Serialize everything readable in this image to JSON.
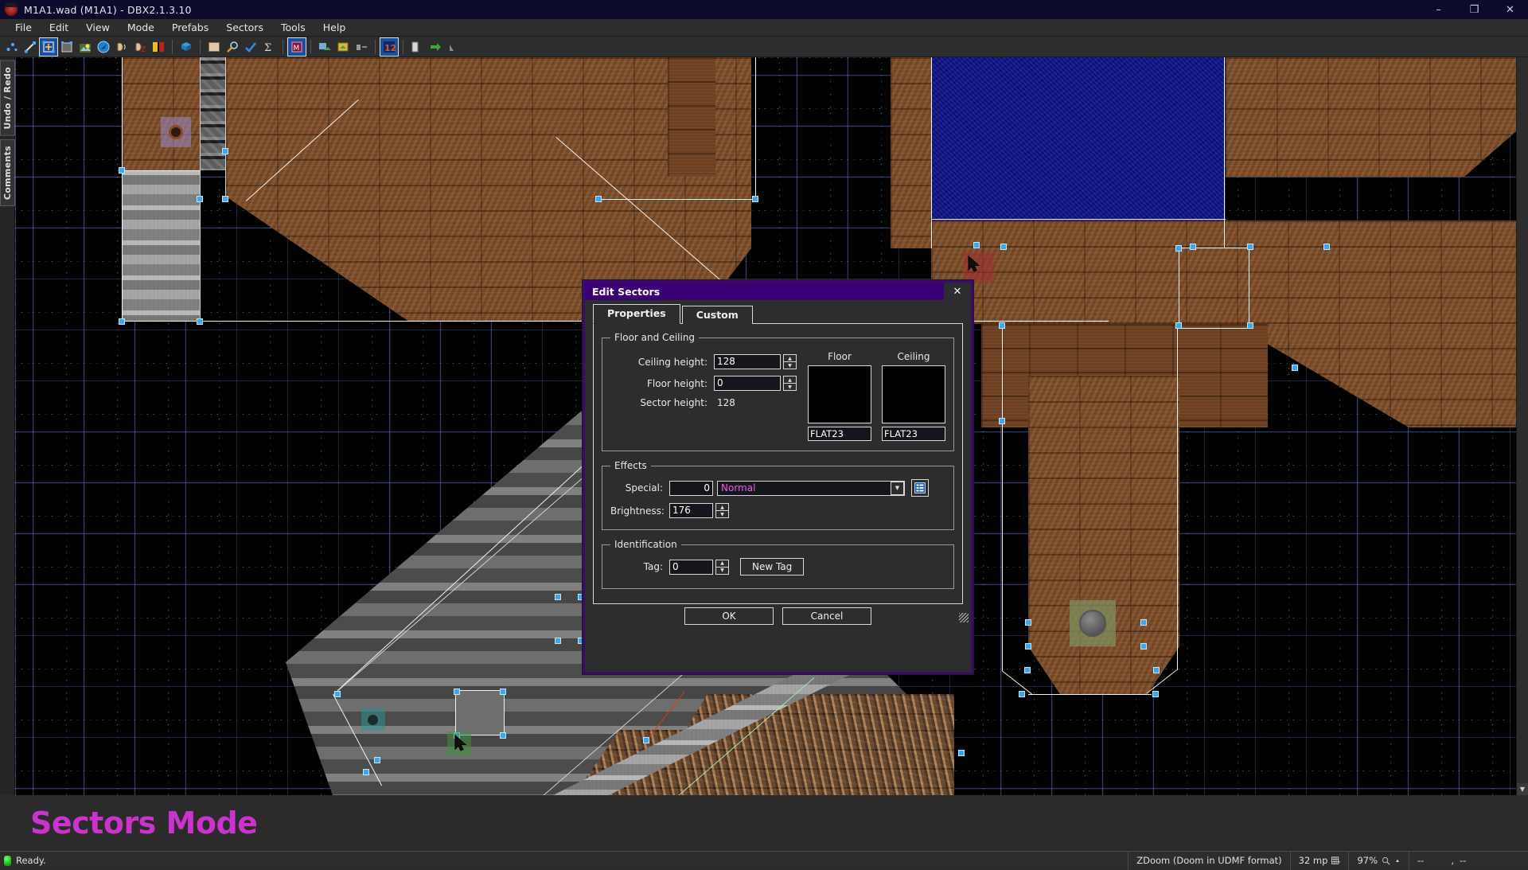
{
  "window": {
    "title": "M1A1.wad (M1A1) - DBX2.1.3.10",
    "app_icon": "bug-icon",
    "minimize": "–",
    "maximize": "❐",
    "close": "✕"
  },
  "menubar": {
    "items": [
      {
        "label": "File"
      },
      {
        "label": "Edit"
      },
      {
        "label": "View"
      },
      {
        "label": "Mode"
      },
      {
        "label": "Prefabs"
      },
      {
        "label": "Sectors"
      },
      {
        "label": "Tools"
      },
      {
        "label": "Help"
      }
    ]
  },
  "toolbar": {
    "groups": [
      {
        "buttons": [
          {
            "name": "vertices-mode-icon",
            "selected": false
          },
          {
            "name": "linedefs-mode-icon",
            "selected": false
          },
          {
            "name": "sectors-mode-icon",
            "selected": true
          },
          {
            "name": "things-mode-icon",
            "selected": false
          },
          {
            "name": "edit-selection-mode-icon",
            "selected": false
          },
          {
            "name": "visual-mode-icon",
            "selected": false
          },
          {
            "name": "sound-environment-icon",
            "selected": false
          },
          {
            "name": "sound-propagation-icon",
            "selected": false
          },
          {
            "name": "brightness-mode-icon",
            "selected": false
          }
        ]
      },
      {
        "buttons": [
          {
            "name": "3d-floor-mode-icon",
            "selected": false
          }
        ]
      },
      {
        "buttons": [
          {
            "name": "texture-browser-icon",
            "selected": false
          },
          {
            "name": "find-replace-icon",
            "selected": false
          },
          {
            "name": "map-analysis-icon",
            "selected": false
          },
          {
            "name": "statistics-icon",
            "selected": false
          }
        ]
      },
      {
        "buttons": [
          {
            "name": "script-editor-icon",
            "selected": false
          }
        ]
      },
      {
        "buttons": [
          {
            "name": "import-icon",
            "selected": false
          },
          {
            "name": "export-icon",
            "selected": false
          },
          {
            "name": "snap-to-grid-icon",
            "selected": false
          }
        ]
      },
      {
        "buttons": [
          {
            "name": "grid-size-12-icon",
            "selected": true
          }
        ]
      },
      {
        "buttons": [
          {
            "name": "test-map-icon",
            "selected": false
          },
          {
            "name": "run-map-icon",
            "selected": false
          },
          {
            "name": "stop-icon",
            "selected": false
          }
        ]
      }
    ]
  },
  "left_dock": {
    "tabs": [
      {
        "label": "Undo / Redo"
      },
      {
        "label": "Comments"
      }
    ]
  },
  "mode_label": "Sectors Mode",
  "mode_label_color": "#cc33cc",
  "dialog": {
    "title": "Edit Sectors",
    "close_label": "✕",
    "tabs": [
      {
        "label": "Properties",
        "active": true
      },
      {
        "label": "Custom",
        "active": false
      }
    ],
    "floor_ceiling": {
      "legend": "Floor and Ceiling",
      "ceiling_height_label": "Ceiling height:",
      "ceiling_height_value": "128",
      "floor_height_label": "Floor height:",
      "floor_height_value": "0",
      "sector_height_label": "Sector height:",
      "sector_height_value": "128",
      "floor_panel_label": "Floor",
      "floor_texture": "FLAT23",
      "ceiling_panel_label": "Ceiling",
      "ceiling_texture": "FLAT23",
      "spin_up": "▲",
      "spin_down": "▼"
    },
    "effects": {
      "legend": "Effects",
      "special_label": "Special:",
      "special_value": "0",
      "special_name": "Normal",
      "special_name_color": "#ee55ee",
      "dropdown_arrow": "▼",
      "browse_icon": "list-browse-icon",
      "brightness_label": "Brightness:",
      "brightness_value": "176"
    },
    "identification": {
      "legend": "Identification",
      "tag_label": "Tag:",
      "tag_value": "0",
      "new_tag_label": "New Tag"
    },
    "footer": {
      "ok_label": "OK",
      "cancel_label": "Cancel"
    },
    "resize_grip": "resize-grip-icon"
  },
  "statusbar": {
    "led_color": "#13c013",
    "message": "Ready.",
    "game_config": "ZDoom (Doom in UDMF format)",
    "grid_size": "32 mp",
    "grid_icon": "grid-icon",
    "zoom": "97%",
    "zoom_icon": "magnifier-icon",
    "coord_x": "--",
    "coord_separator": ",",
    "coord_y": "--"
  },
  "canvas": {
    "background": "#000000",
    "grid_color": "#5a6ebe",
    "vertex_color": "#3ba7f0",
    "linedef_color": "#f2f2f2",
    "special_linedef_color": "#e03a10",
    "textures": {
      "wood": "#7a4a26",
      "water": "#0e1273",
      "metal": "#9a9a9a",
      "gray_cave": "#5d5d5d",
      "rock": "#8a6240"
    },
    "things": [
      {
        "name": "thing-purple",
        "color": "#9a86c8"
      },
      {
        "name": "thing-red",
        "color": "#a03030"
      },
      {
        "name": "thing-teal",
        "color": "#2e8f8f"
      },
      {
        "name": "thing-green",
        "color": "#3f8f3f"
      },
      {
        "name": "thing-decor",
        "color": "#7f8f5f"
      }
    ]
  }
}
